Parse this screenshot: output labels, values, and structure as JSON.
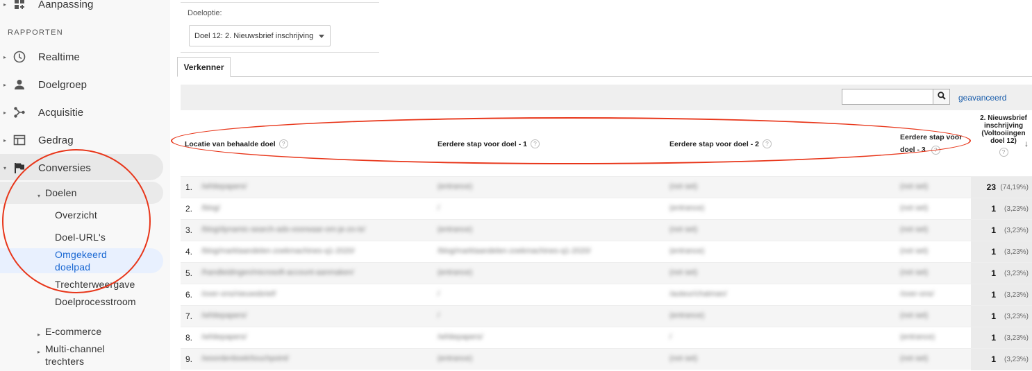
{
  "sidebar": {
    "top_item": {
      "label": "Aanpassing",
      "icon": "dashboard-grid-icon"
    },
    "section_title": "RAPPORTEN",
    "items": [
      {
        "label": "Realtime",
        "icon": "clock-icon"
      },
      {
        "label": "Doelgroep",
        "icon": "person-icon"
      },
      {
        "label": "Acquisitie",
        "icon": "acquisition-icon"
      },
      {
        "label": "Gedrag",
        "icon": "window-icon"
      },
      {
        "label": "Conversies",
        "icon": "flag-icon"
      }
    ],
    "doelen": {
      "label": "Doelen",
      "children": [
        "Overzicht",
        "Doel-URL's",
        "Omgekeerd doelpad",
        "Trechterweergave",
        "Doelprocesstroom"
      ]
    },
    "ecommerce": "E-commerce",
    "multichannel": "Multi-channel trechters"
  },
  "goal_option": {
    "label": "Doeloptie:",
    "selected": "Doel 12: 2. Nieuwsbrief inschrijving"
  },
  "tab": "Verkenner",
  "search": {
    "value": "",
    "advanced_link": "geavanceerd"
  },
  "table": {
    "columns": [
      "Locatie van behaalde doel",
      "Eerdere stap voor doel - 1",
      "Eerdere stap voor doel - 2",
      "Eerdere stap voor doel - 3"
    ],
    "metric_column": "2. Nieuwsbrief inschrijving (Voltooiingen doel 12)",
    "rows": [
      {
        "num": "1.",
        "c1": "/whitepapers/",
        "c2": "(entrance)",
        "c3": "(not set)",
        "c4": "(not set)",
        "value": "23",
        "pct": "(74,19%)"
      },
      {
        "num": "2.",
        "c1": "/blog/",
        "c2": "/",
        "c3": "(entrance)",
        "c4": "(not set)",
        "value": "1",
        "pct": "(3,23%)"
      },
      {
        "num": "3.",
        "c1": "/blog/dynamic-search-ads-voorwaar-om-je-zo-is/",
        "c2": "(entrance)",
        "c3": "(not set)",
        "c4": "(not set)",
        "value": "1",
        "pct": "(3,23%)"
      },
      {
        "num": "4.",
        "c1": "/blog/marktaandelen-zoekmachines-q1-2020/",
        "c2": "/blog/marktaandelen-zoekmachines-q1-2020/",
        "c3": "(entrance)",
        "c4": "(not set)",
        "value": "1",
        "pct": "(3,23%)"
      },
      {
        "num": "5.",
        "c1": "/handleidingen/microsoft-account-aanmaken/",
        "c2": "(entrance)",
        "c3": "(not set)",
        "c4": "(not set)",
        "value": "1",
        "pct": "(3,23%)"
      },
      {
        "num": "6.",
        "c1": "/over-ons/nieuwsbrief/",
        "c2": "/",
        "c3": "/auteur/chatman/",
        "c4": "/over-ons/",
        "value": "1",
        "pct": "(3,23%)"
      },
      {
        "num": "7.",
        "c1": "/whitepapers/",
        "c2": "/",
        "c3": "(entrance)",
        "c4": "(not set)",
        "value": "1",
        "pct": "(3,23%)"
      },
      {
        "num": "8.",
        "c1": "/whitepapers/",
        "c2": "/whitepapers/",
        "c3": "/",
        "c4": "(entrance)",
        "value": "1",
        "pct": "(3,23%)"
      },
      {
        "num": "9.",
        "c1": "/woordenboek/touchpoint/",
        "c2": "(entrance)",
        "c3": "(not set)",
        "c4": "(not set)",
        "value": "1",
        "pct": "(3,23%)"
      }
    ]
  }
}
